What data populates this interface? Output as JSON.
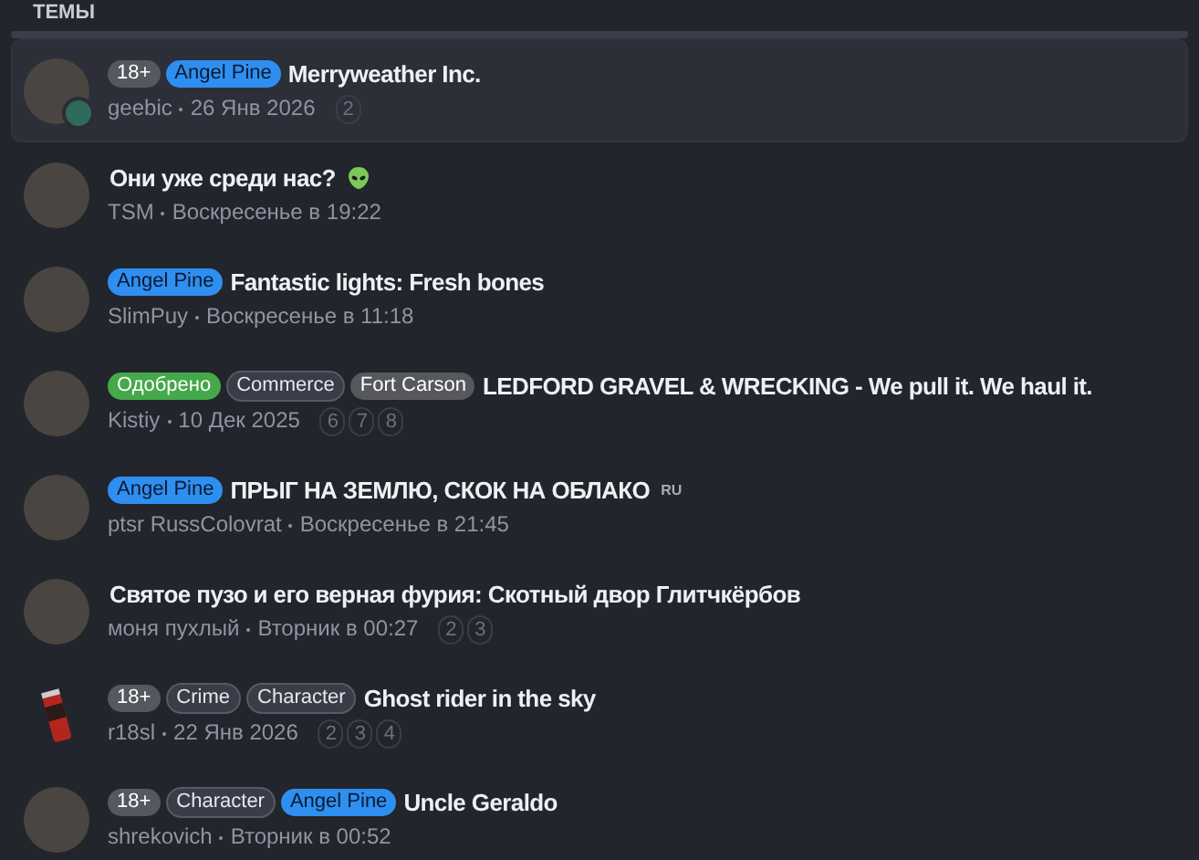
{
  "section": {
    "title": "ТЕМЫ"
  },
  "threads": [
    {
      "kind": "photo",
      "selected": true,
      "second_avatar": true,
      "prefixes": [
        {
          "label": "18+",
          "kind": "age"
        },
        {
          "label": "Angel Pine",
          "kind": "location"
        }
      ],
      "title": "Merryweather Inc.",
      "author": "geebic",
      "date": "26 Янв 2026",
      "pages": [
        "2"
      ]
    },
    {
      "kind": "photo",
      "selected": false,
      "alien": true,
      "title": "Они уже среди нас?",
      "author": "TSM",
      "date": "Воскресенье в 19:22"
    },
    {
      "kind": "photo",
      "selected": false,
      "prefixes": [
        {
          "label": "Angel Pine",
          "kind": "location"
        }
      ],
      "title": "Fantastic lights: Fresh bones",
      "author": "SlimPuy",
      "date": "Воскресенье в 11:18"
    },
    {
      "kind": "photo",
      "selected": false,
      "prefixes": [
        {
          "label": "Одобрено",
          "kind": "status"
        },
        {
          "label": "Commerce",
          "kind": "category"
        },
        {
          "label": "Fort Carson",
          "kind": "region"
        }
      ],
      "title": "LEDFORD GRAVEL & WRECKING - We pull it. We haul it.",
      "author": "Kistiy",
      "date": "10 Дек 2025",
      "pages": [
        "6",
        "7",
        "8"
      ]
    },
    {
      "kind": "photo",
      "selected": false,
      "prefixes": [
        {
          "label": "Angel Pine",
          "kind": "location"
        }
      ],
      "title": "ПРЫГ НА ЗЕМЛЮ, СКОК НА ОБЛАКО",
      "lang": "RU",
      "author": "ptsr RussColovrat",
      "date": "Воскресенье в 21:45"
    },
    {
      "kind": "photo",
      "selected": false,
      "title": "Святое пузо и его верная фурия: Скотный двор Глитчкёрбов",
      "author": "моня пухлый",
      "date": "Вторник в 00:27",
      "pages": [
        "2",
        "3"
      ]
    },
    {
      "kind": "can",
      "selected": false,
      "prefixes": [
        {
          "label": "18+",
          "kind": "age"
        },
        {
          "label": "Crime",
          "kind": "category"
        },
        {
          "label": "Character",
          "kind": "category"
        }
      ],
      "title": "Ghost rider in the sky",
      "author": "r18sl",
      "date": "22 Янв 2026",
      "pages": [
        "2",
        "3",
        "4"
      ]
    },
    {
      "kind": "photo",
      "selected": false,
      "prefixes": [
        {
          "label": "18+",
          "kind": "age"
        },
        {
          "label": "Character",
          "kind": "category"
        },
        {
          "label": "Angel Pine",
          "kind": "location"
        }
      ],
      "title": "Uncle Geraldo",
      "author": "shrekovich",
      "date": "Вторник в 00:52"
    }
  ]
}
